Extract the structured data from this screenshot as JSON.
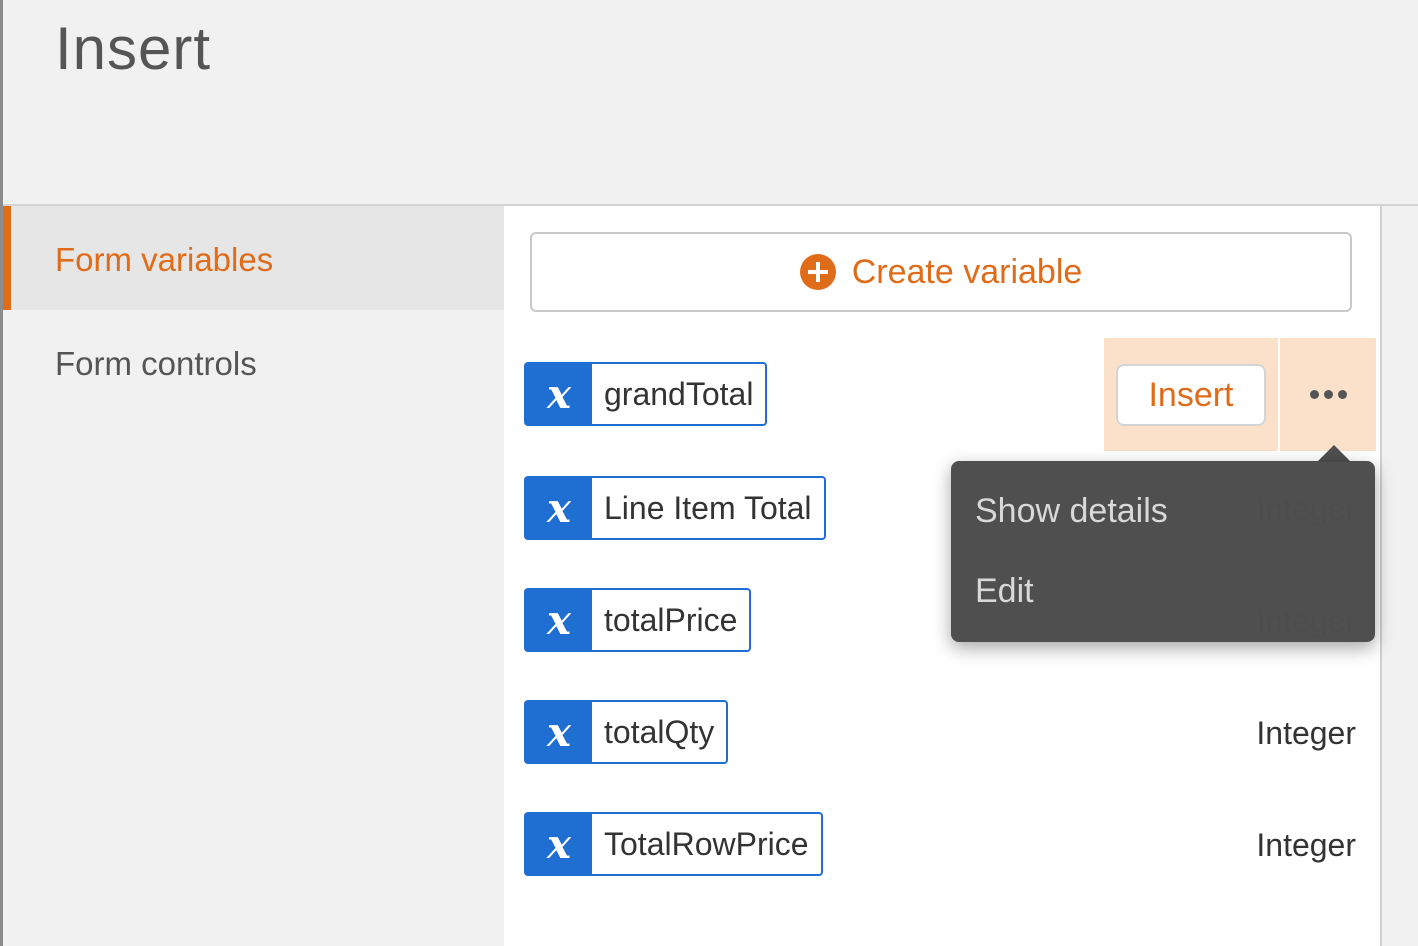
{
  "header": {
    "title": "Insert"
  },
  "sidebar": {
    "items": [
      {
        "label": "Form variables",
        "active": true
      },
      {
        "label": "Form controls",
        "active": false
      }
    ]
  },
  "main": {
    "create_button": {
      "label": "Create variable",
      "icon": "plus-circle-icon"
    },
    "variables": [
      {
        "icon": "variable-x-icon",
        "name": "grandTotal",
        "type": ""
      },
      {
        "icon": "variable-x-icon",
        "name": "Line Item Total",
        "type": "Integer"
      },
      {
        "icon": "variable-x-icon",
        "name": "totalPrice",
        "type": "Integer"
      },
      {
        "icon": "variable-x-icon",
        "name": "totalQty",
        "type": "Integer"
      },
      {
        "icon": "variable-x-icon",
        "name": "TotalRowPrice",
        "type": "Integer"
      }
    ],
    "row_actions": {
      "insert_label": "Insert",
      "more_icon": "more-horizontal-icon"
    }
  },
  "dropdown": {
    "items": [
      {
        "label": "Show details"
      },
      {
        "label": "Edit"
      }
    ]
  },
  "colors": {
    "accent": "#e06c1a",
    "variable_blue": "#1f6fd2",
    "hover_highlight": "#fbe1c9",
    "menu_bg": "#484848"
  }
}
